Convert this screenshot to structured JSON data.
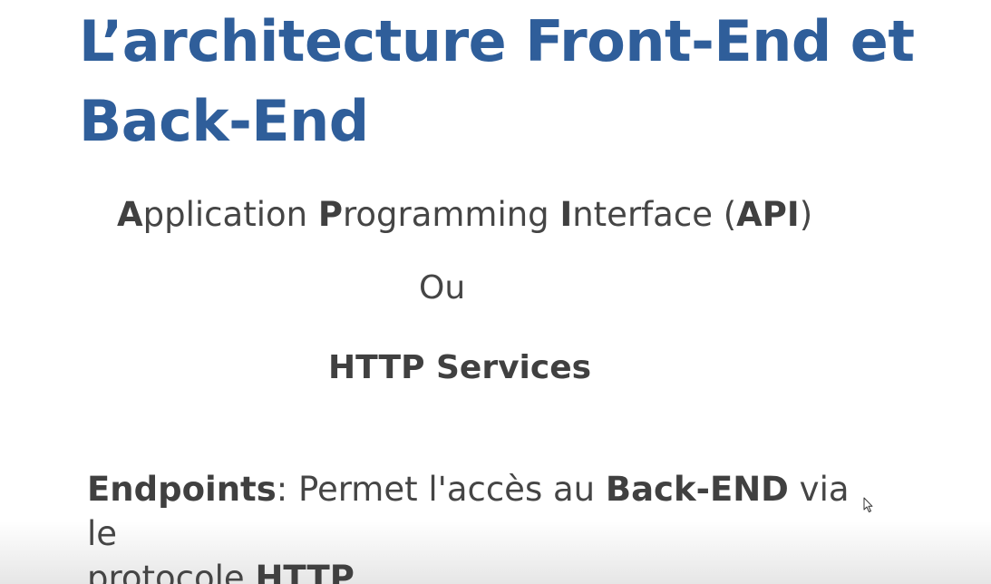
{
  "slide": {
    "title_line1": "L’architecture Front-End et",
    "title_line2": "Back-End",
    "api": {
      "a": "A",
      "pplication": "pplication ",
      "p": "P",
      "rogramming": "rogramming ",
      "i": "I",
      "nterface": "nterface (",
      "acronym": "API",
      "close": ")"
    },
    "or_word": "Ou",
    "http_services": "HTTP Services",
    "endpoints": {
      "term": "Endpoints",
      "colon_text": ":  Permet  l'accès au ",
      "backend": "Back-END",
      "via_text": " via le",
      "protocol_text": "protocole ",
      "http": "HTTP"
    }
  },
  "colors": {
    "title": "#2f5e9a",
    "body_text": "#454545"
  },
  "icons": {
    "cursor": "mouse-pointer-icon"
  }
}
